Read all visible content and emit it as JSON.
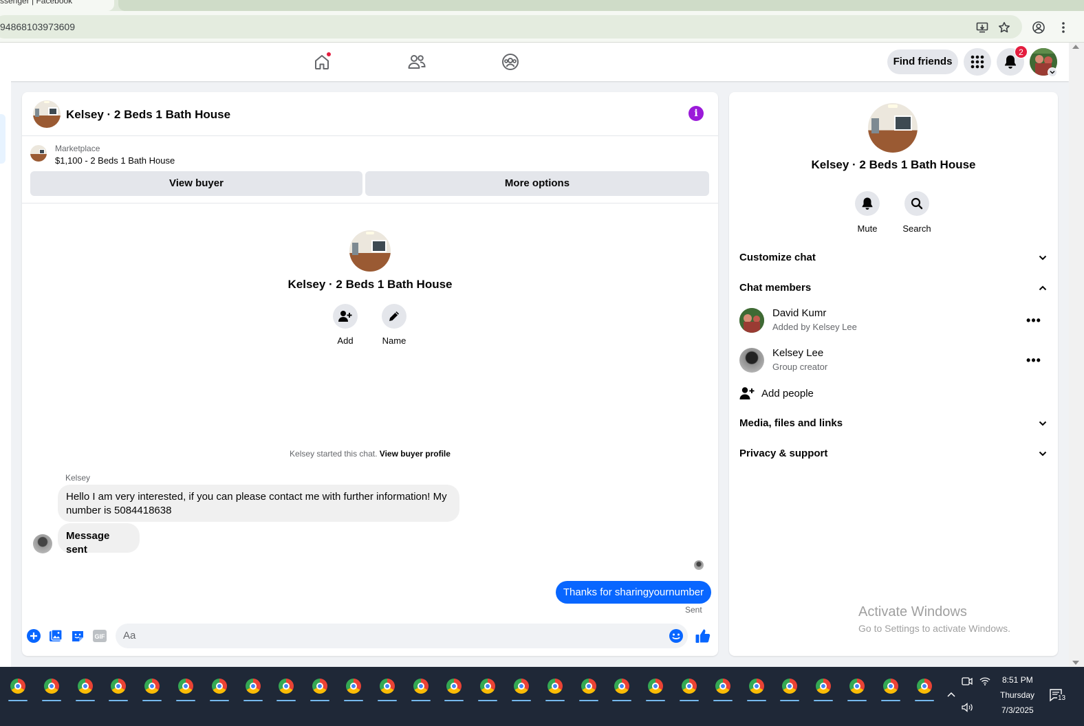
{
  "browser": {
    "tab_title": "ssenger | Facebook",
    "url": "94868103973609"
  },
  "header": {
    "find_friends": "Find friends",
    "notification_count": "2"
  },
  "chat": {
    "title": "Kelsey · 2 Beds 1 Bath House",
    "marketplace": {
      "label": "Marketplace",
      "listing": "$1,100 - 2 Beds 1 Bath House",
      "view_buyer": "View buyer",
      "more_options": "More options"
    },
    "profile": {
      "name": "Kelsey · 2 Beds 1 Bath House",
      "add_label": "Add",
      "name_label": "Name"
    },
    "started_text": "Kelsey started this chat.",
    "view_buyer_profile": "View buyer profile",
    "messages": [
      {
        "sender": "Kelsey",
        "text": "Hello I am very interested, if you can please contact me with further information! My number is 5084418638"
      },
      {
        "text": "Message sent"
      }
    ],
    "outgoing": {
      "text": "Thanks for sharingyournumber",
      "status": "Sent"
    },
    "composer_placeholder": "Aa"
  },
  "right_panel": {
    "name": "Kelsey · 2 Beds 1 Bath House",
    "mute": "Mute",
    "search": "Search",
    "sections": {
      "customize": "Customize chat",
      "members": "Chat members",
      "media": "Media, files and links",
      "privacy": "Privacy & support"
    },
    "members": [
      {
        "name": "David Kumr",
        "sub": "Added by Kelsey Lee"
      },
      {
        "name": "Kelsey Lee",
        "sub": "Group creator"
      }
    ],
    "add_people": "Add people",
    "watermark_title": "Activate Windows",
    "watermark_sub": "Go to Settings to activate Windows."
  },
  "taskbar": {
    "time": "8:51 PM",
    "day": "Thursday",
    "date": "7/3/2025",
    "notification_count": "13"
  },
  "colors": {
    "accent": "#0866ff",
    "info": "#9b1ad9",
    "badge": "#e41e3f"
  }
}
